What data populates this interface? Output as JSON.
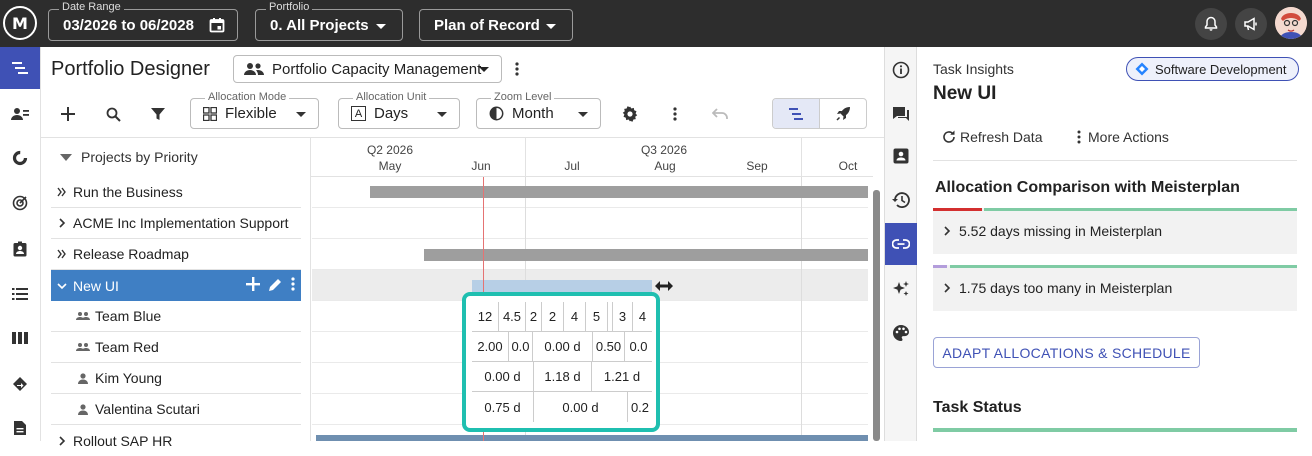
{
  "topbar": {
    "logo_text": "M",
    "date_range_label": "Date Range",
    "date_range_value": "03/2026 to 06/2028",
    "portfolio_label": "Portfolio",
    "portfolio_value": "0. All Projects",
    "plan_value": "Plan of Record"
  },
  "header": {
    "title": "Portfolio Designer",
    "selector_value": "Portfolio Capacity Management"
  },
  "toolbar": {
    "allocation_mode_label": "Allocation Mode",
    "allocation_mode_value": "Flexible",
    "allocation_unit_label": "Allocation Unit",
    "allocation_unit_value": "Days",
    "allocation_unit_icon_text": "A",
    "zoom_level_label": "Zoom Level",
    "zoom_level_value": "Month"
  },
  "tree": {
    "header": "Projects by Priority",
    "rows": [
      {
        "label": "Run the Business"
      },
      {
        "label": "ACME Inc Implementation Support"
      },
      {
        "label": "Release Roadmap"
      },
      {
        "label": "New UI"
      },
      {
        "label": "Team Blue"
      },
      {
        "label": "Team Red"
      },
      {
        "label": "Kim Young"
      },
      {
        "label": "Valentina Scutari"
      },
      {
        "label": "Rollout SAP HR"
      }
    ]
  },
  "timeline": {
    "quarters": [
      "Q2 2026",
      "Q3 2026"
    ],
    "months": [
      "May",
      "Jun",
      "Jul",
      "Aug",
      "Sep",
      "Oct"
    ]
  },
  "cells": {
    "team_blue": [
      "12",
      "4.5",
      "2",
      "2",
      "4",
      "5",
      "3",
      "4"
    ],
    "team_red": [
      "2.00",
      "0.0",
      "0.00 d",
      "0.50",
      "0.0"
    ],
    "kim_young": [
      "0.00 d",
      "1.18 d",
      "1.21 d"
    ],
    "valentina": [
      "0.75 d",
      "0.00 d",
      "0.2"
    ]
  },
  "panel": {
    "subtitle": "Task Insights",
    "title": "New UI",
    "chip": "Software Development",
    "refresh": "Refresh Data",
    "more_actions": "More Actions",
    "comparison_title": "Allocation Comparison with Meisterplan",
    "missing_text": "5.52 days missing in Meisterplan",
    "too_many_text": "1.75 days too many in Meisterplan",
    "adapt_button": "ADAPT ALLOCATIONS & SCHEDULE",
    "task_status_title": "Task Status"
  },
  "colors": {
    "accent": "#3f51b5",
    "selected_row": "#3f7fc4",
    "highlight_border": "#1fbfb0",
    "missing_bar": "#d32f2f",
    "ok_bar": "#7fcba4"
  }
}
